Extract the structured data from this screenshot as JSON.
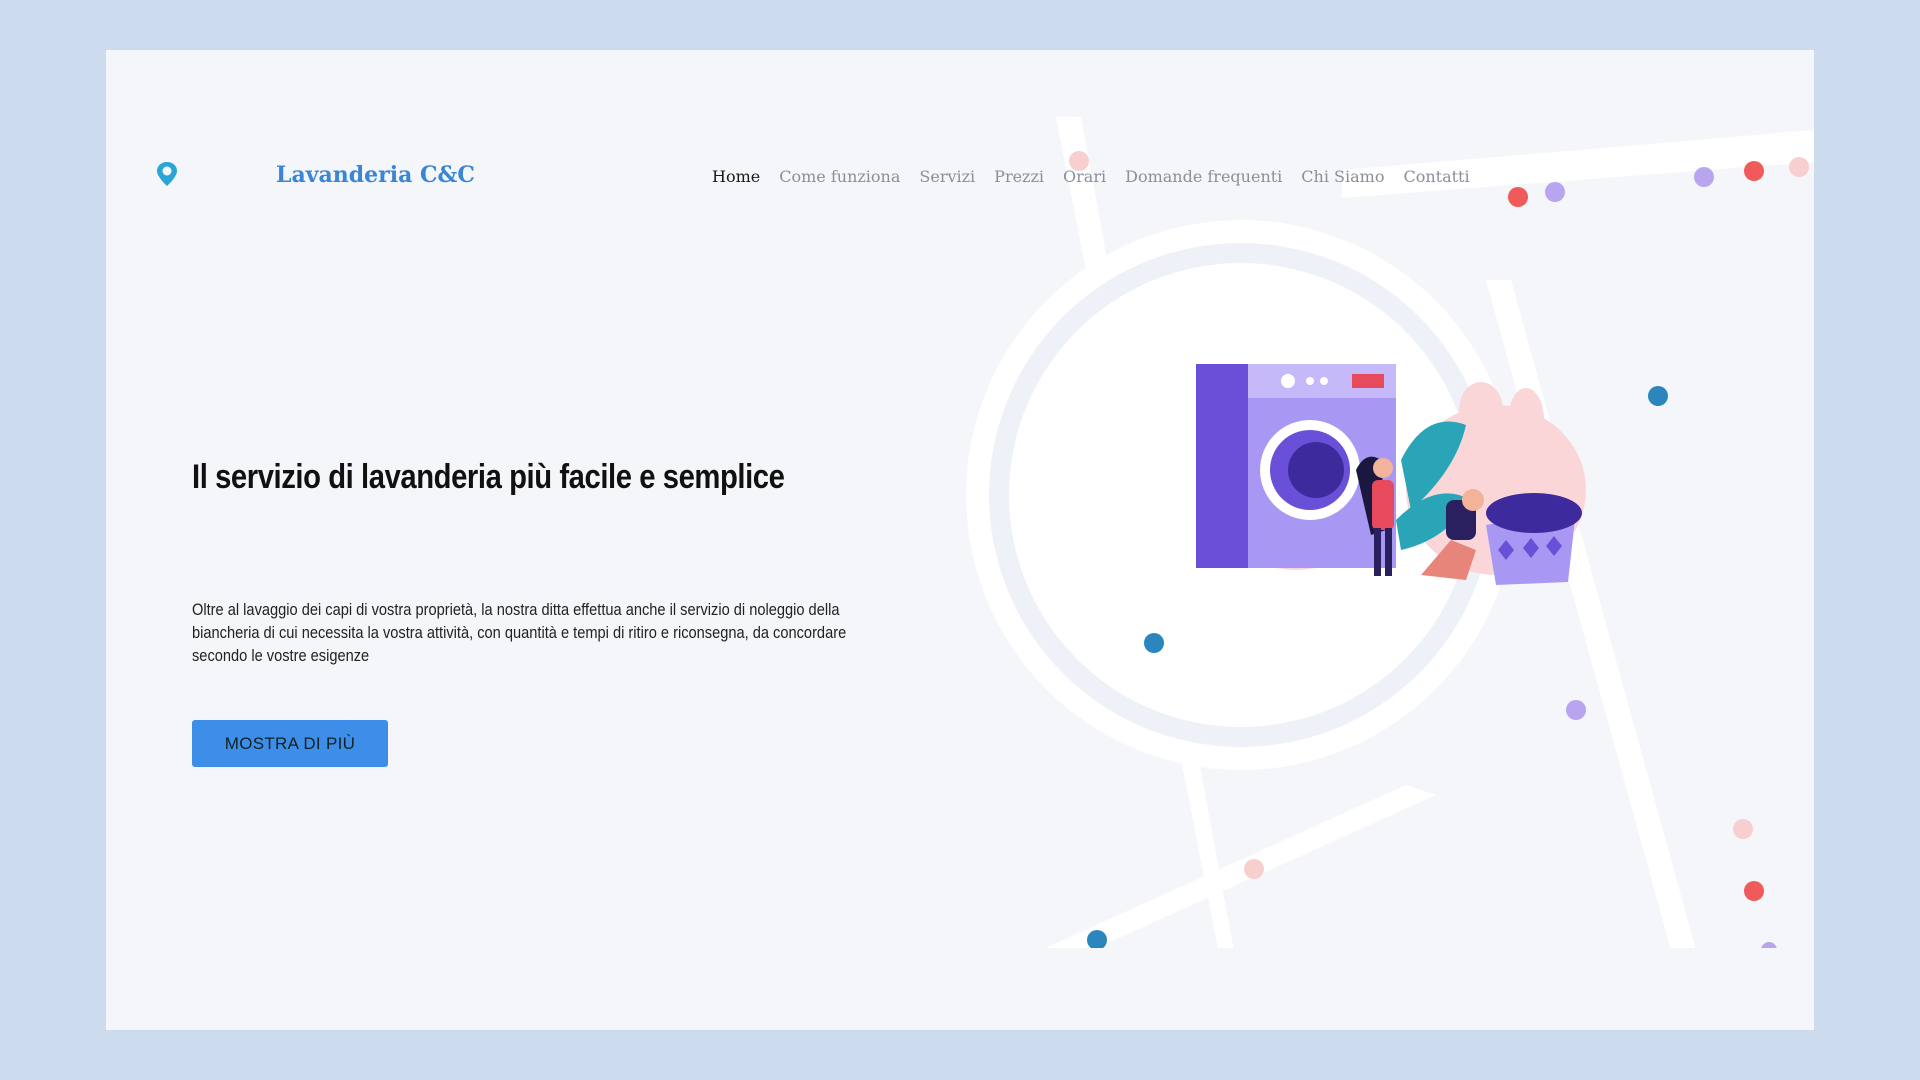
{
  "brand": {
    "name": "Lavanderia C&C",
    "logo_icon": "location-pin-icon",
    "accent_color": "#3a86d6"
  },
  "nav": {
    "items": [
      {
        "label": "Home",
        "active": true
      },
      {
        "label": "Come funziona",
        "active": false
      },
      {
        "label": "Servizi",
        "active": false
      },
      {
        "label": "Prezzi",
        "active": false
      },
      {
        "label": "Orari",
        "active": false
      },
      {
        "label": "Domande frequenti",
        "active": false
      },
      {
        "label": "Chi Siamo",
        "active": false
      },
      {
        "label": "Contatti",
        "active": false
      }
    ]
  },
  "hero": {
    "title": "Il servizio di lavanderia più facile e semplice",
    "description": "Oltre al lavaggio dei capi di vostra proprietà, la nostra ditta effettua anche il servizio di noleggio della biancheria di cui necessita la vostra attività, con quantità e tempi di ritiro e riconsegna, da concordare secondo le vostre esigenze",
    "cta_label": "MOSTRA DI PIÙ",
    "cta_color": "#3d8ee8"
  },
  "colors": {
    "page_background": "#ccdcee",
    "content_background": "#f4f6fa",
    "dot_red": "#f05a5a",
    "dot_pink": "#f8cfcf",
    "dot_purple": "#b9a4f0",
    "dot_blue": "#2b86bd",
    "washer_purple": "#6a4fd8",
    "washer_light": "#a998f3"
  },
  "illustration": {
    "icon": "laundry-illustration"
  }
}
